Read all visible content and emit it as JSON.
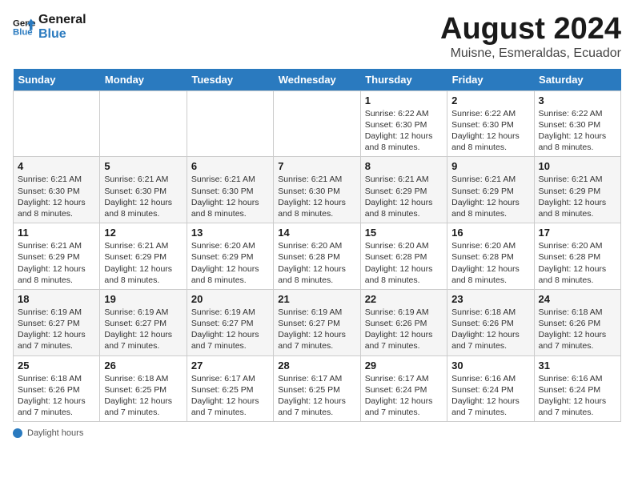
{
  "header": {
    "logo_line1": "General",
    "logo_line2": "Blue",
    "month_year": "August 2024",
    "location": "Muisne, Esmeraldas, Ecuador"
  },
  "weekdays": [
    "Sunday",
    "Monday",
    "Tuesday",
    "Wednesday",
    "Thursday",
    "Friday",
    "Saturday"
  ],
  "weeks": [
    [
      {
        "day": "",
        "detail": ""
      },
      {
        "day": "",
        "detail": ""
      },
      {
        "day": "",
        "detail": ""
      },
      {
        "day": "",
        "detail": ""
      },
      {
        "day": "1",
        "detail": "Sunrise: 6:22 AM\nSunset: 6:30 PM\nDaylight: 12 hours and 8 minutes."
      },
      {
        "day": "2",
        "detail": "Sunrise: 6:22 AM\nSunset: 6:30 PM\nDaylight: 12 hours and 8 minutes."
      },
      {
        "day": "3",
        "detail": "Sunrise: 6:22 AM\nSunset: 6:30 PM\nDaylight: 12 hours and 8 minutes."
      }
    ],
    [
      {
        "day": "4",
        "detail": "Sunrise: 6:21 AM\nSunset: 6:30 PM\nDaylight: 12 hours and 8 minutes."
      },
      {
        "day": "5",
        "detail": "Sunrise: 6:21 AM\nSunset: 6:30 PM\nDaylight: 12 hours and 8 minutes."
      },
      {
        "day": "6",
        "detail": "Sunrise: 6:21 AM\nSunset: 6:30 PM\nDaylight: 12 hours and 8 minutes."
      },
      {
        "day": "7",
        "detail": "Sunrise: 6:21 AM\nSunset: 6:30 PM\nDaylight: 12 hours and 8 minutes."
      },
      {
        "day": "8",
        "detail": "Sunrise: 6:21 AM\nSunset: 6:29 PM\nDaylight: 12 hours and 8 minutes."
      },
      {
        "day": "9",
        "detail": "Sunrise: 6:21 AM\nSunset: 6:29 PM\nDaylight: 12 hours and 8 minutes."
      },
      {
        "day": "10",
        "detail": "Sunrise: 6:21 AM\nSunset: 6:29 PM\nDaylight: 12 hours and 8 minutes."
      }
    ],
    [
      {
        "day": "11",
        "detail": "Sunrise: 6:21 AM\nSunset: 6:29 PM\nDaylight: 12 hours and 8 minutes."
      },
      {
        "day": "12",
        "detail": "Sunrise: 6:21 AM\nSunset: 6:29 PM\nDaylight: 12 hours and 8 minutes."
      },
      {
        "day": "13",
        "detail": "Sunrise: 6:20 AM\nSunset: 6:29 PM\nDaylight: 12 hours and 8 minutes."
      },
      {
        "day": "14",
        "detail": "Sunrise: 6:20 AM\nSunset: 6:28 PM\nDaylight: 12 hours and 8 minutes."
      },
      {
        "day": "15",
        "detail": "Sunrise: 6:20 AM\nSunset: 6:28 PM\nDaylight: 12 hours and 8 minutes."
      },
      {
        "day": "16",
        "detail": "Sunrise: 6:20 AM\nSunset: 6:28 PM\nDaylight: 12 hours and 8 minutes."
      },
      {
        "day": "17",
        "detail": "Sunrise: 6:20 AM\nSunset: 6:28 PM\nDaylight: 12 hours and 8 minutes."
      }
    ],
    [
      {
        "day": "18",
        "detail": "Sunrise: 6:19 AM\nSunset: 6:27 PM\nDaylight: 12 hours and 7 minutes."
      },
      {
        "day": "19",
        "detail": "Sunrise: 6:19 AM\nSunset: 6:27 PM\nDaylight: 12 hours and 7 minutes."
      },
      {
        "day": "20",
        "detail": "Sunrise: 6:19 AM\nSunset: 6:27 PM\nDaylight: 12 hours and 7 minutes."
      },
      {
        "day": "21",
        "detail": "Sunrise: 6:19 AM\nSunset: 6:27 PM\nDaylight: 12 hours and 7 minutes."
      },
      {
        "day": "22",
        "detail": "Sunrise: 6:19 AM\nSunset: 6:26 PM\nDaylight: 12 hours and 7 minutes."
      },
      {
        "day": "23",
        "detail": "Sunrise: 6:18 AM\nSunset: 6:26 PM\nDaylight: 12 hours and 7 minutes."
      },
      {
        "day": "24",
        "detail": "Sunrise: 6:18 AM\nSunset: 6:26 PM\nDaylight: 12 hours and 7 minutes."
      }
    ],
    [
      {
        "day": "25",
        "detail": "Sunrise: 6:18 AM\nSunset: 6:26 PM\nDaylight: 12 hours and 7 minutes."
      },
      {
        "day": "26",
        "detail": "Sunrise: 6:18 AM\nSunset: 6:25 PM\nDaylight: 12 hours and 7 minutes."
      },
      {
        "day": "27",
        "detail": "Sunrise: 6:17 AM\nSunset: 6:25 PM\nDaylight: 12 hours and 7 minutes."
      },
      {
        "day": "28",
        "detail": "Sunrise: 6:17 AM\nSunset: 6:25 PM\nDaylight: 12 hours and 7 minutes."
      },
      {
        "day": "29",
        "detail": "Sunrise: 6:17 AM\nSunset: 6:24 PM\nDaylight: 12 hours and 7 minutes."
      },
      {
        "day": "30",
        "detail": "Sunrise: 6:16 AM\nSunset: 6:24 PM\nDaylight: 12 hours and 7 minutes."
      },
      {
        "day": "31",
        "detail": "Sunrise: 6:16 AM\nSunset: 6:24 PM\nDaylight: 12 hours and 7 minutes."
      }
    ]
  ],
  "footer": {
    "label": "Daylight hours"
  }
}
